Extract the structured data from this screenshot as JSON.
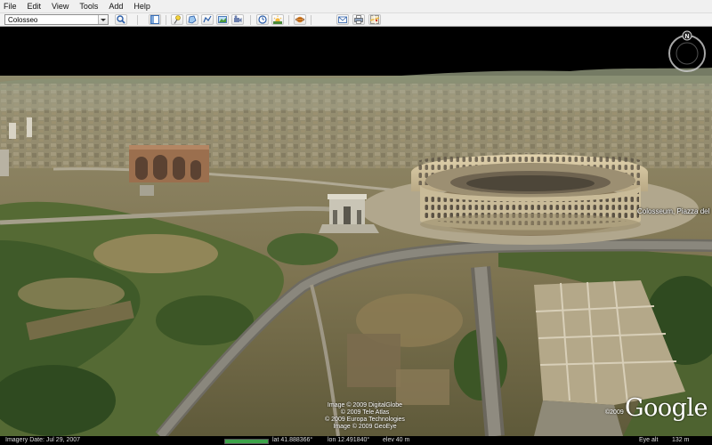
{
  "menu": [
    "File",
    "Edit",
    "View",
    "Tools",
    "Add",
    "Help"
  ],
  "search": {
    "value": "Colosseo"
  },
  "toolbar": {
    "buttons": [
      "search-button",
      "sidebar-toggle-button",
      "placemark-button",
      "polygon-button",
      "path-button",
      "image-overlay-button",
      "record-tour-button",
      "historical-imagery-button",
      "sunlight-button",
      "switch-to-sky-button",
      "email-button",
      "print-button",
      "google-maps-button"
    ]
  },
  "globe": {
    "place_label": "Colosseum, Piazza del",
    "credits": [
      "Image © 2009 DigitalGlobe",
      "© 2009 Tele Atlas",
      "© 2009 Europa Technologies",
      "Image © 2009 GeoEye"
    ],
    "logo_year": "©2009",
    "logo_text": "Google",
    "compass_letter": "N"
  },
  "status": {
    "imagery_date": "Imagery Date: Jul 29, 2007",
    "lat": "lat  41.888366°",
    "lon": "lon  12.491840°",
    "elev": "elev  40 m",
    "streaming_progress": 1.0,
    "eye_alt": "Eye alt",
    "eye_alt_value": "132 m"
  },
  "colors": {
    "sky": "#000000",
    "toolbar": "#f0f0f0",
    "streaming": "#3da34a"
  }
}
